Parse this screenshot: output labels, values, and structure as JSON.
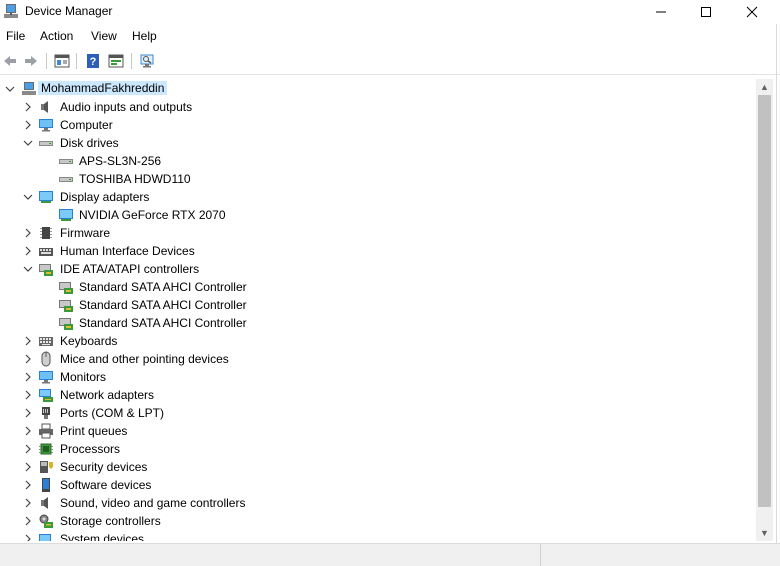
{
  "window": {
    "title": "Device Manager"
  },
  "menu": [
    "File",
    "Action",
    "View",
    "Help"
  ],
  "toolbar": {
    "buttons": [
      "back-arrow-icon",
      "forward-arrow-icon",
      "properties-icon",
      "help-icon",
      "update-driver-icon",
      "scan-hardware-icon"
    ]
  },
  "tree": {
    "root": "MohammadFakhreddin",
    "items": [
      {
        "label": "Audio inputs and outputs",
        "icon": "speaker-icon",
        "expanded": false
      },
      {
        "label": "Computer",
        "icon": "computer-icon",
        "expanded": false
      },
      {
        "label": "Disk drives",
        "icon": "disk-drive-icon",
        "expanded": true,
        "children": [
          "APS-SL3N-256",
          "TOSHIBA HDWD110"
        ]
      },
      {
        "label": "Display adapters",
        "icon": "display-adapter-icon",
        "expanded": true,
        "children": [
          "NVIDIA GeForce RTX 2070"
        ]
      },
      {
        "label": "Firmware",
        "icon": "firmware-icon",
        "expanded": false
      },
      {
        "label": "Human Interface Devices",
        "icon": "hid-icon",
        "expanded": false
      },
      {
        "label": "IDE ATA/ATAPI controllers",
        "icon": "ide-controller-icon",
        "expanded": true,
        "children": [
          "Standard SATA AHCI Controller",
          "Standard SATA AHCI Controller",
          "Standard SATA AHCI Controller"
        ]
      },
      {
        "label": "Keyboards",
        "icon": "keyboard-icon",
        "expanded": false
      },
      {
        "label": "Mice and other pointing devices",
        "icon": "mouse-icon",
        "expanded": false
      },
      {
        "label": "Monitors",
        "icon": "monitor-icon",
        "expanded": false
      },
      {
        "label": "Network adapters",
        "icon": "network-adapter-icon",
        "expanded": false
      },
      {
        "label": "Ports (COM & LPT)",
        "icon": "port-icon",
        "expanded": false
      },
      {
        "label": "Print queues",
        "icon": "printer-icon",
        "expanded": false
      },
      {
        "label": "Processors",
        "icon": "processor-icon",
        "expanded": false
      },
      {
        "label": "Security devices",
        "icon": "security-device-icon",
        "expanded": false
      },
      {
        "label": "Software devices",
        "icon": "software-device-icon",
        "expanded": false
      },
      {
        "label": "Sound, video and game controllers",
        "icon": "sound-controller-icon",
        "expanded": false
      },
      {
        "label": "Storage controllers",
        "icon": "storage-controller-icon",
        "expanded": false
      },
      {
        "label": "System devices",
        "icon": "system-device-icon",
        "expanded": false
      }
    ]
  },
  "colors": {
    "selection": "#cce8ff",
    "accent": "#0078d7"
  }
}
